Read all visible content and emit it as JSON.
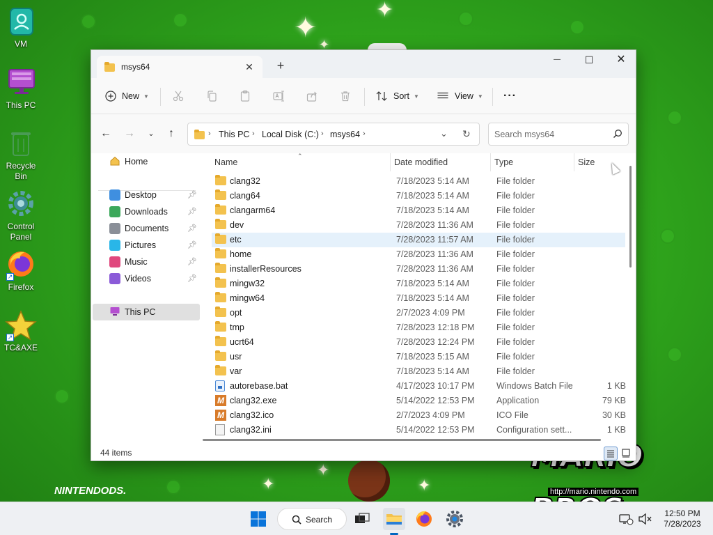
{
  "desktop": {
    "icons": [
      {
        "label": "VM",
        "icon": "vm-icon"
      },
      {
        "label": "This PC",
        "icon": "monitor-icon"
      },
      {
        "label": "Recycle Bin",
        "icon": "recycle-bin-icon"
      },
      {
        "label": "Control Panel",
        "icon": "gear-icon"
      },
      {
        "label": "Firefox",
        "icon": "firefox-icon"
      },
      {
        "label": "TC&AXE",
        "icon": "star-icon"
      }
    ],
    "wallpaper": {
      "logo_text": "MARIO BROS.",
      "url": "http://mario.nintendo.com",
      "nds_prefix": "NINTENDO",
      "nds_suffix": "DS."
    }
  },
  "window": {
    "tab_title": "msys64",
    "tab_close": "✕",
    "new_tab": "+",
    "controls": {
      "minimize": "—",
      "maximize": "☐",
      "close": "✕"
    },
    "commands": {
      "new_label": "New",
      "sort_label": "Sort",
      "view_label": "View",
      "more_label": "···"
    },
    "address": {
      "crumbs": [
        "This PC",
        "Local Disk (C:)",
        "msys64"
      ]
    },
    "search": {
      "placeholder": "Search msys64"
    },
    "sidebar": {
      "home": "Home",
      "items": [
        {
          "label": "Desktop",
          "color": "#3f8fe0"
        },
        {
          "label": "Downloads",
          "color": "#3ca85b"
        },
        {
          "label": "Documents",
          "color": "#8a8f98"
        },
        {
          "label": "Pictures",
          "color": "#29b6e8"
        },
        {
          "label": "Music",
          "color": "#e0487e"
        },
        {
          "label": "Videos",
          "color": "#8b5bd8"
        }
      ],
      "this_pc": "This PC"
    },
    "columns": {
      "name": "Name",
      "date": "Date modified",
      "type": "Type",
      "size": "Size"
    },
    "files": [
      {
        "name": "clang32",
        "date": "7/18/2023 5:14 AM",
        "type": "File folder",
        "size": "",
        "kind": "folder"
      },
      {
        "name": "clang64",
        "date": "7/18/2023 5:14 AM",
        "type": "File folder",
        "size": "",
        "kind": "folder"
      },
      {
        "name": "clangarm64",
        "date": "7/18/2023 5:14 AM",
        "type": "File folder",
        "size": "",
        "kind": "folder"
      },
      {
        "name": "dev",
        "date": "7/28/2023 11:36 AM",
        "type": "File folder",
        "size": "",
        "kind": "folder"
      },
      {
        "name": "etc",
        "date": "7/28/2023 11:57 AM",
        "type": "File folder",
        "size": "",
        "kind": "folder",
        "selected": true
      },
      {
        "name": "home",
        "date": "7/28/2023 11:36 AM",
        "type": "File folder",
        "size": "",
        "kind": "folder"
      },
      {
        "name": "installerResources",
        "date": "7/28/2023 11:36 AM",
        "type": "File folder",
        "size": "",
        "kind": "folder"
      },
      {
        "name": "mingw32",
        "date": "7/18/2023 5:14 AM",
        "type": "File folder",
        "size": "",
        "kind": "folder"
      },
      {
        "name": "mingw64",
        "date": "7/18/2023 5:14 AM",
        "type": "File folder",
        "size": "",
        "kind": "folder"
      },
      {
        "name": "opt",
        "date": "2/7/2023 4:09 PM",
        "type": "File folder",
        "size": "",
        "kind": "folder"
      },
      {
        "name": "tmp",
        "date": "7/28/2023 12:18 PM",
        "type": "File folder",
        "size": "",
        "kind": "folder"
      },
      {
        "name": "ucrt64",
        "date": "7/28/2023 12:24 PM",
        "type": "File folder",
        "size": "",
        "kind": "folder"
      },
      {
        "name": "usr",
        "date": "7/18/2023 5:15 AM",
        "type": "File folder",
        "size": "",
        "kind": "folder"
      },
      {
        "name": "var",
        "date": "7/18/2023 5:14 AM",
        "type": "File folder",
        "size": "",
        "kind": "folder"
      },
      {
        "name": "autorebase.bat",
        "date": "4/17/2023 10:17 PM",
        "type": "Windows Batch File",
        "size": "1 KB",
        "kind": "bat"
      },
      {
        "name": "clang32.exe",
        "date": "5/14/2022 12:53 PM",
        "type": "Application",
        "size": "79 KB",
        "kind": "msys"
      },
      {
        "name": "clang32.ico",
        "date": "2/7/2023 4:09 PM",
        "type": "ICO File",
        "size": "30 KB",
        "kind": "msys"
      },
      {
        "name": "clang32.ini",
        "date": "5/14/2022 12:53 PM",
        "type": "Configuration sett...",
        "size": "1 KB",
        "kind": "ini"
      }
    ],
    "status": {
      "item_count": "44 items"
    }
  },
  "taskbar": {
    "search_label": "Search",
    "time": "12:50 PM",
    "date": "7/28/2023"
  }
}
